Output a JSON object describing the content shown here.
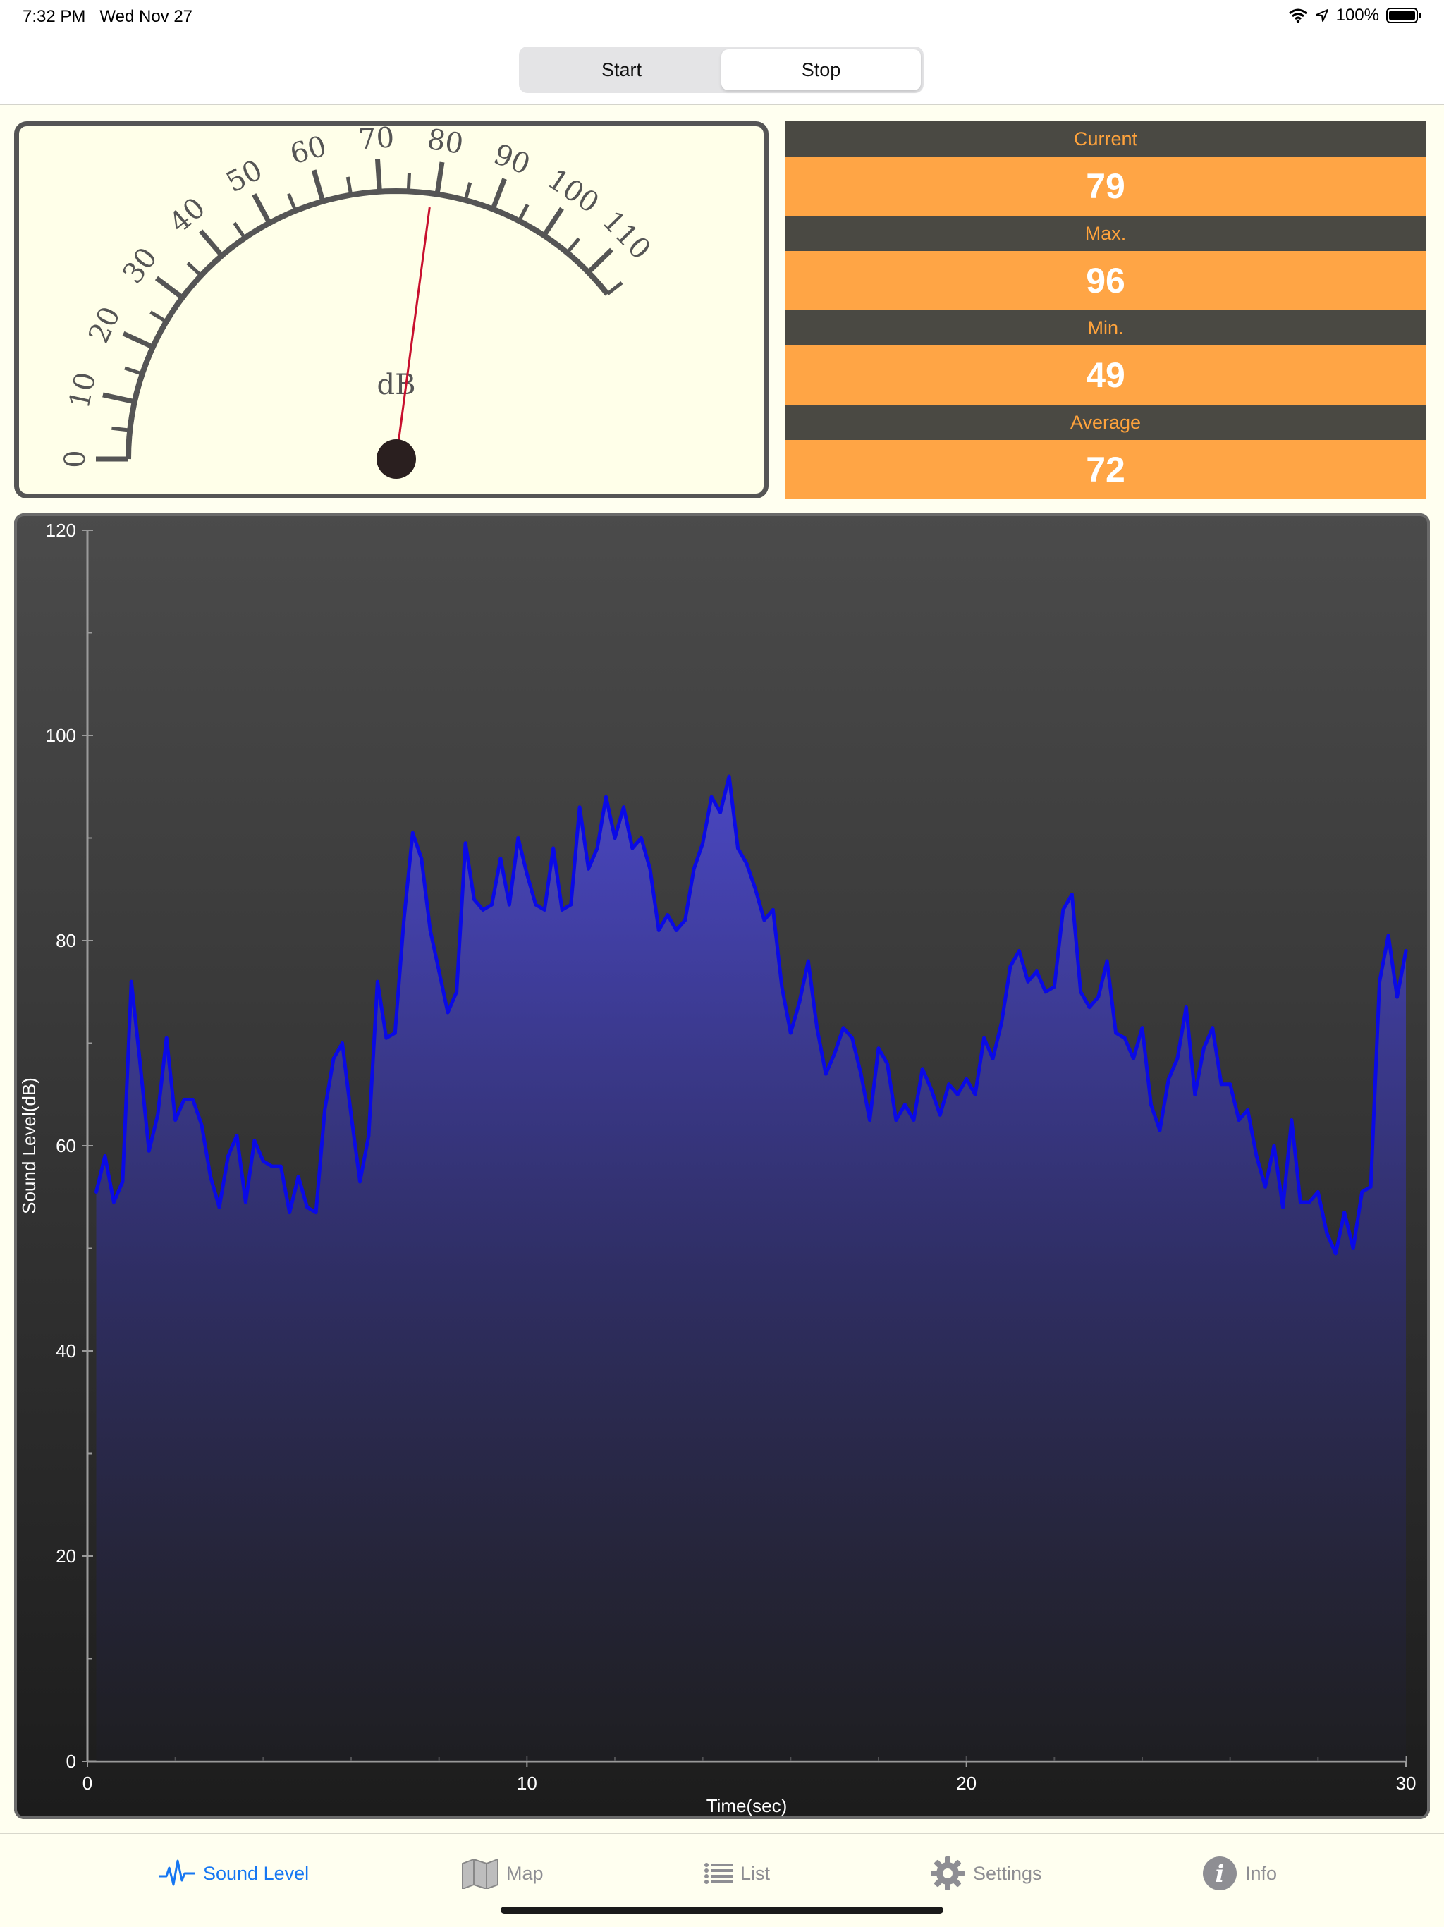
{
  "status_bar": {
    "time": "7:32 PM",
    "date": "Wed Nov 27",
    "battery": "100%"
  },
  "header": {
    "start_label": "Start",
    "stop_label": "Stop"
  },
  "meter": {
    "unit": "dB",
    "value": 79,
    "scale_labels": [
      "0",
      "10",
      "20",
      "30",
      "40",
      "50",
      "60",
      "70",
      "80",
      "90",
      "100",
      "110"
    ]
  },
  "readouts": {
    "current_label": "Current",
    "current_value": "79",
    "max_label": "Max.",
    "max_value": "96",
    "min_label": "Min.",
    "min_value": "49",
    "average_label": "Average",
    "average_value": "72"
  },
  "chart_data": {
    "type": "area",
    "xlabel": "Time(sec)",
    "ylabel": "Sound Level(dB)",
    "xlim": [
      0,
      30
    ],
    "ylim": [
      0,
      120
    ],
    "x_ticks": [
      "0",
      "10",
      "20",
      "30"
    ],
    "y_ticks": [
      "0",
      "20",
      "40",
      "60",
      "80",
      "100",
      "120"
    ],
    "line_color": "#0A0AE6",
    "x": [
      0.2,
      0.4,
      0.6,
      0.8,
      1.0,
      1.2,
      1.4,
      1.6,
      1.8,
      2.0,
      2.2,
      2.4,
      2.6,
      2.8,
      3.0,
      3.2,
      3.4,
      3.6,
      3.8,
      4.0,
      4.2,
      4.4,
      4.6,
      4.8,
      5.0,
      5.2,
      5.4,
      5.6,
      5.8,
      6.0,
      6.2,
      6.4,
      6.6,
      6.8,
      7.0,
      7.2,
      7.4,
      7.6,
      7.8,
      8.0,
      8.2,
      8.4,
      8.6,
      8.8,
      9.0,
      9.2,
      9.4,
      9.6,
      9.8,
      10.0,
      10.2,
      10.4,
      10.6,
      10.8,
      11.0,
      11.2,
      11.4,
      11.6,
      11.8,
      12.0,
      12.2,
      12.4,
      12.6,
      12.8,
      13.0,
      13.2,
      13.4,
      13.6,
      13.8,
      14.0,
      14.2,
      14.4,
      14.6,
      14.8,
      15.0,
      15.2,
      15.4,
      15.6,
      15.8,
      16.0,
      16.2,
      16.4,
      16.6,
      16.8,
      17.0,
      17.2,
      17.4,
      17.6,
      17.8,
      18.0,
      18.2,
      18.4,
      18.6,
      18.8,
      19.0,
      19.2,
      19.4,
      19.6,
      19.8,
      20.0,
      20.2,
      20.4,
      20.6,
      20.8,
      21.0,
      21.2,
      21.4,
      21.6,
      21.8,
      22.0,
      22.2,
      22.4,
      22.6,
      22.8,
      23.0,
      23.2,
      23.4,
      23.6,
      23.8,
      24.0,
      24.2,
      24.4,
      24.6,
      24.8,
      25.0,
      25.2,
      25.4,
      25.6,
      25.8,
      26.0,
      26.2,
      26.4,
      26.6,
      26.8,
      27.0,
      27.2,
      27.4,
      27.6,
      27.8,
      28.0,
      28.2,
      28.4,
      28.6,
      28.8,
      29.0,
      29.2,
      29.4,
      29.6,
      29.8,
      30.0
    ],
    "values": [
      55.5,
      59,
      54.5,
      56.5,
      76,
      68,
      59.5,
      63,
      70.5,
      62.5,
      64.5,
      64.5,
      62,
      57,
      54,
      59,
      61,
      54.5,
      60.5,
      58.5,
      58,
      58,
      53.5,
      57,
      54,
      53.5,
      63.5,
      68.5,
      70,
      63,
      56.5,
      61,
      76,
      70.5,
      71,
      82,
      90.5,
      88,
      81,
      77,
      73,
      75,
      89.5,
      84,
      83,
      83.5,
      88,
      83.5,
      90,
      86.5,
      83.5,
      83,
      89,
      83,
      83.5,
      93,
      87,
      89,
      94,
      90,
      93,
      89,
      90,
      87,
      81,
      82.5,
      81,
      82,
      87,
      89.5,
      94,
      92.5,
      96,
      89,
      87.5,
      85,
      82,
      83,
      75.5,
      71,
      74,
      78,
      71.5,
      67,
      69,
      71.5,
      70.5,
      67,
      62.5,
      69.5,
      68,
      62.5,
      64,
      62.5,
      67.5,
      65.5,
      63,
      66,
      65,
      66.5,
      65,
      70.5,
      68.5,
      72,
      77.5,
      79,
      76,
      77,
      75,
      75.5,
      83,
      84.5,
      75,
      73.5,
      74.5,
      78,
      71,
      70.5,
      68.5,
      71.5,
      64,
      61.5,
      66.5,
      68.5,
      73.5,
      65,
      69.5,
      71.5,
      66,
      66,
      62.5,
      63.5,
      59,
      56,
      60,
      54,
      62.5,
      54.5,
      54.5,
      55.5,
      51.5,
      49.5,
      53.5,
      50,
      55.5,
      56,
      76,
      80.5,
      74.5,
      79
    ]
  },
  "tabbar": {
    "items": [
      {
        "label": "Sound Level",
        "icon": "waveform-icon"
      },
      {
        "label": "Map",
        "icon": "map-icon"
      },
      {
        "label": "List",
        "icon": "list-icon"
      },
      {
        "label": "Settings",
        "icon": "gear-icon"
      },
      {
        "label": "Info",
        "icon": "info-icon"
      }
    ],
    "active_color": "#1677F2"
  }
}
